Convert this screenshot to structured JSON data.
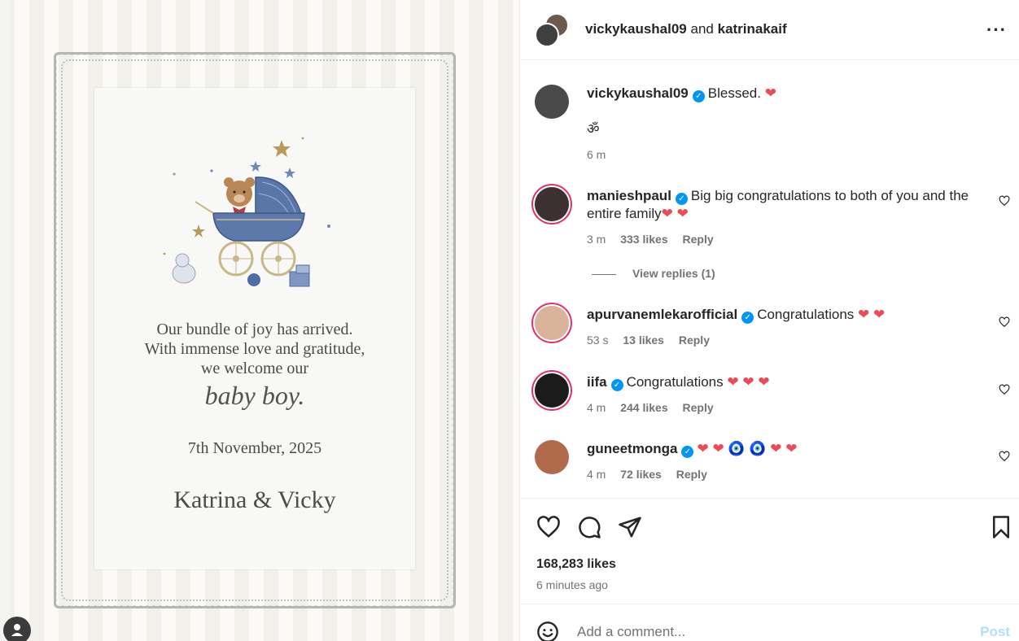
{
  "post": {
    "card": {
      "line1": "Our bundle of joy has arrived.",
      "line2": "With immense love and gratitude,",
      "line3": "we welcome our",
      "baby": "baby boy.",
      "date": "7th November, 2025",
      "names": "Katrina & Vicky"
    }
  },
  "header": {
    "user1": "vickykaushal09",
    "joiner": "and",
    "user2": "katrinakaif",
    "more_icon": "more-horizontal-icon"
  },
  "caption": {
    "user": "vickykaushal09",
    "text": "Blessed. ❤",
    "line2": "ॐ",
    "time": "6 m"
  },
  "comments": [
    {
      "user": "manieshpaul",
      "text": "Big big congratulations to both of you and the entire family❤ ❤",
      "time": "3 m",
      "likes": "333 likes",
      "reply": "Reply",
      "avatar_color": "#3a3130"
    },
    {
      "user": "apurvanemlekarofficial",
      "text": "Congratulations ❤ ❤",
      "time": "53 s",
      "likes": "13 likes",
      "reply": "Reply",
      "avatar_color": "#d9b49a"
    },
    {
      "user": "iifa",
      "text": "Congratulations ❤ ❤ ❤",
      "time": "4 m",
      "likes": "244 likes",
      "reply": "Reply",
      "avatar_color": "#1b1b1b"
    },
    {
      "user": "guneetmonga",
      "text": "❤ ❤ 🧿 🧿 ❤ ❤",
      "time": "4 m",
      "likes": "72 likes",
      "reply": "Reply",
      "avatar_color": "#b06a4a"
    }
  ],
  "view_replies": "View replies (1)",
  "stats": {
    "likes": "168,283 likes",
    "time_ago": "6 minutes ago"
  },
  "add_comment": {
    "placeholder": "Add a comment...",
    "post_label": "Post"
  },
  "colors": {
    "heart": "#ed4956",
    "verified": "#0095f6",
    "muted": "#737373",
    "post_disabled": "#b2dffc"
  }
}
